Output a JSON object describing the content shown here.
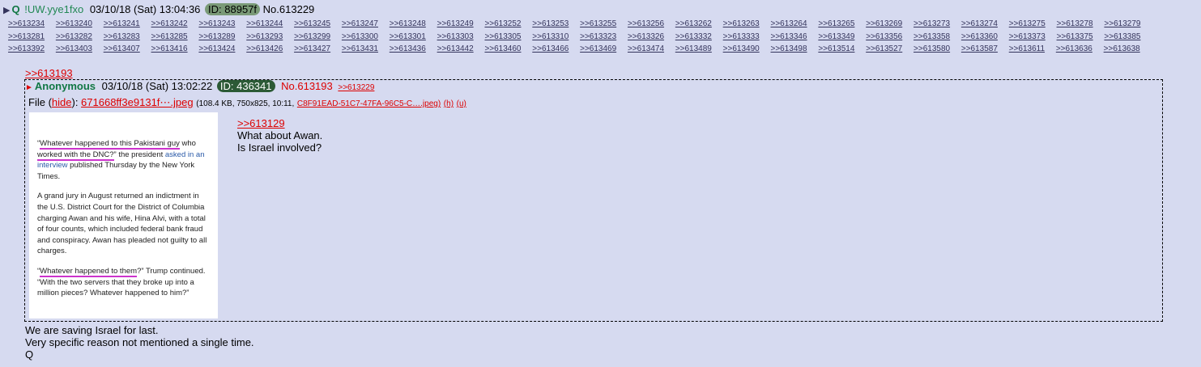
{
  "op": {
    "name": "Q",
    "tripcode": "!UW.yye1fxo",
    "datetime": "03/10/18 (Sat) 13:04:36",
    "id_label": "ID: 88957f",
    "post_no": "No.613229",
    "replies": [
      ">>613234",
      ">>613240",
      ">>613241",
      ">>613242",
      ">>613243",
      ">>613244",
      ">>613245",
      ">>613247",
      ">>613248",
      ">>613249",
      ">>613252",
      ">>613253",
      ">>613255",
      ">>613256",
      ">>613262",
      ">>613263",
      ">>613264",
      ">>613265",
      ">>613269",
      ">>613273",
      ">>613274",
      ">>613275",
      ">>613278",
      ">>613279",
      ">>613281",
      ">>613282",
      ">>613283",
      ">>613285",
      ">>613289",
      ">>613293",
      ">>613299",
      ">>613300",
      ">>613301",
      ">>613303",
      ">>613305",
      ">>613310",
      ">>613323",
      ">>613326",
      ">>613332",
      ">>613333",
      ">>613346",
      ">>613349",
      ">>613356",
      ">>613358",
      ">>613360",
      ">>613373",
      ">>613375",
      ">>613385",
      ">>613392",
      ">>613403",
      ">>613407",
      ">>613416",
      ">>613424",
      ">>613426",
      ">>613427",
      ">>613431",
      ">>613436",
      ">>613442",
      ">>613460",
      ">>613466",
      ">>613469",
      ">>613474",
      ">>613489",
      ">>613490",
      ">>613498",
      ">>613514",
      ">>613527",
      ">>613580",
      ">>613587",
      ">>613611",
      ">>613636",
      ">>613638"
    ],
    "quote_link": ">>613193",
    "body_lines": [
      "We are saving Israel for last.",
      "Very specific reason not mentioned a single time.",
      "Q"
    ]
  },
  "reply": {
    "name": "Anonymous",
    "datetime": "03/10/18 (Sat) 13:02:22",
    "id_label": "ID: 436341",
    "post_no": "No.613193",
    "backlink": ">>613229",
    "file_label": "File",
    "hide_label": "hide",
    "file_name": "671668ff3e9131f⋯.jpeg",
    "file_meta": "(108.4 KB, 750x825, 10:11,",
    "file_orig": "C8F91EAD-51C7-47FA-96C5-C….jpeg)",
    "h_label": "(h)",
    "u_label": "(u)",
    "quote_link": ">>613129",
    "body_lines": [
      "What about Awan.",
      "Is Israel involved?"
    ]
  },
  "thumbnail": {
    "p1_a": "“",
    "p1_hl1": "Whatever happened to this Pakistani guy",
    "p1_b": " who ",
    "p1_hl2": "worked with the DNC?",
    "p1_c": "” the president ",
    "p1_link": "asked in an interview",
    "p1_d": " published Thursday by the New York Times.",
    "p2": "A grand jury in August returned an indictment in the U.S. District Court for the District of Columbia charging Awan and his wife, Hina Alvi, with a total of four counts, which included federal bank fraud and conspiracy. Awan has pleaded not guilty to all charges.",
    "p3_a": "“",
    "p3_hl": "Whatever happened to them",
    "p3_b": "?” Trump continued. “With the two servers that they broke up into a million pieces? Whatever happened to him?”"
  },
  "colors": {
    "background": "#d6daf0",
    "name_green": "#117743",
    "quote_red": "#dd0000",
    "link": "#34345c"
  }
}
